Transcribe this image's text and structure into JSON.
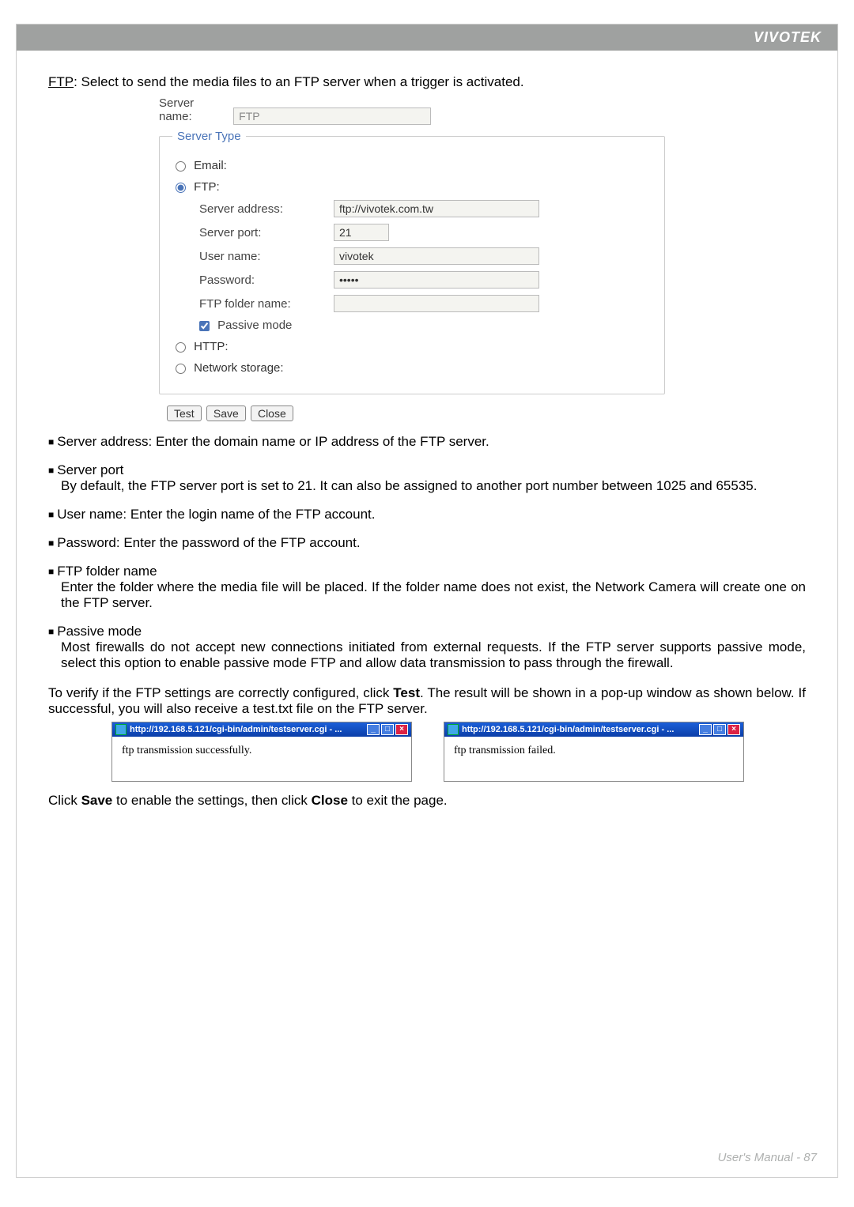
{
  "header": {
    "brand": "VIVOTEK"
  },
  "intro": {
    "label": "FTP",
    "text": ": Select to send the media files to an FTP server when a trigger is activated."
  },
  "form": {
    "server_name_label": "Server name:",
    "server_name_value": "FTP",
    "server_type_legend": "Server Type",
    "options": {
      "email": "Email:",
      "ftp": "FTP:",
      "http": "HTTP:",
      "network_storage": "Network storage:"
    },
    "ftp": {
      "server_address_label": "Server address:",
      "server_address_value": "ftp://vivotek.com.tw",
      "server_port_label": "Server port:",
      "server_port_value": "21",
      "username_label": "User name:",
      "username_value": "vivotek",
      "password_label": "Password:",
      "password_value": "•••••",
      "folder_label": "FTP folder name:",
      "folder_value": "",
      "passive_label": "Passive mode"
    },
    "buttons": {
      "test": "Test",
      "save": "Save",
      "close": "Close"
    }
  },
  "descriptions": {
    "server_address": "Server address: Enter the domain name or IP address of the FTP server.",
    "server_port_h": "Server port",
    "server_port_b": "By default, the FTP server port is set to 21. It can also be assigned to another port number between 1025 and 65535.",
    "username": "User name: Enter the login name of the FTP account.",
    "password": "Password: Enter the password of the FTP account.",
    "folder_h": "FTP folder name",
    "folder_b": "Enter the folder where the media file will be placed. If the folder name does not exist, the Network Camera will create one on the FTP server.",
    "passive_h": "Passive mode",
    "passive_b": "Most firewalls do not accept new connections initiated from external requests. If the FTP server supports passive mode, select this option to enable passive mode FTP and allow data transmission to pass through the firewall."
  },
  "verify": {
    "p1a": "To verify if the FTP settings are correctly configured, click ",
    "p1b": "Test",
    "p1c": ". The result will be shown in a pop-up window as shown below. If successful, you will also receive a test.txt file on the FTP server."
  },
  "popups": {
    "title": "http://192.168.5.121/cgi-bin/admin/testserver.cgi - ...",
    "success": "ftp transmission successfully.",
    "fail": "ftp transmission failed."
  },
  "save_close": {
    "a": "Click ",
    "b": "Save",
    "c": " to enable the settings, then click ",
    "d": "Close",
    "e": " to exit the page."
  },
  "footer": {
    "label": "User's Manual - 87"
  }
}
